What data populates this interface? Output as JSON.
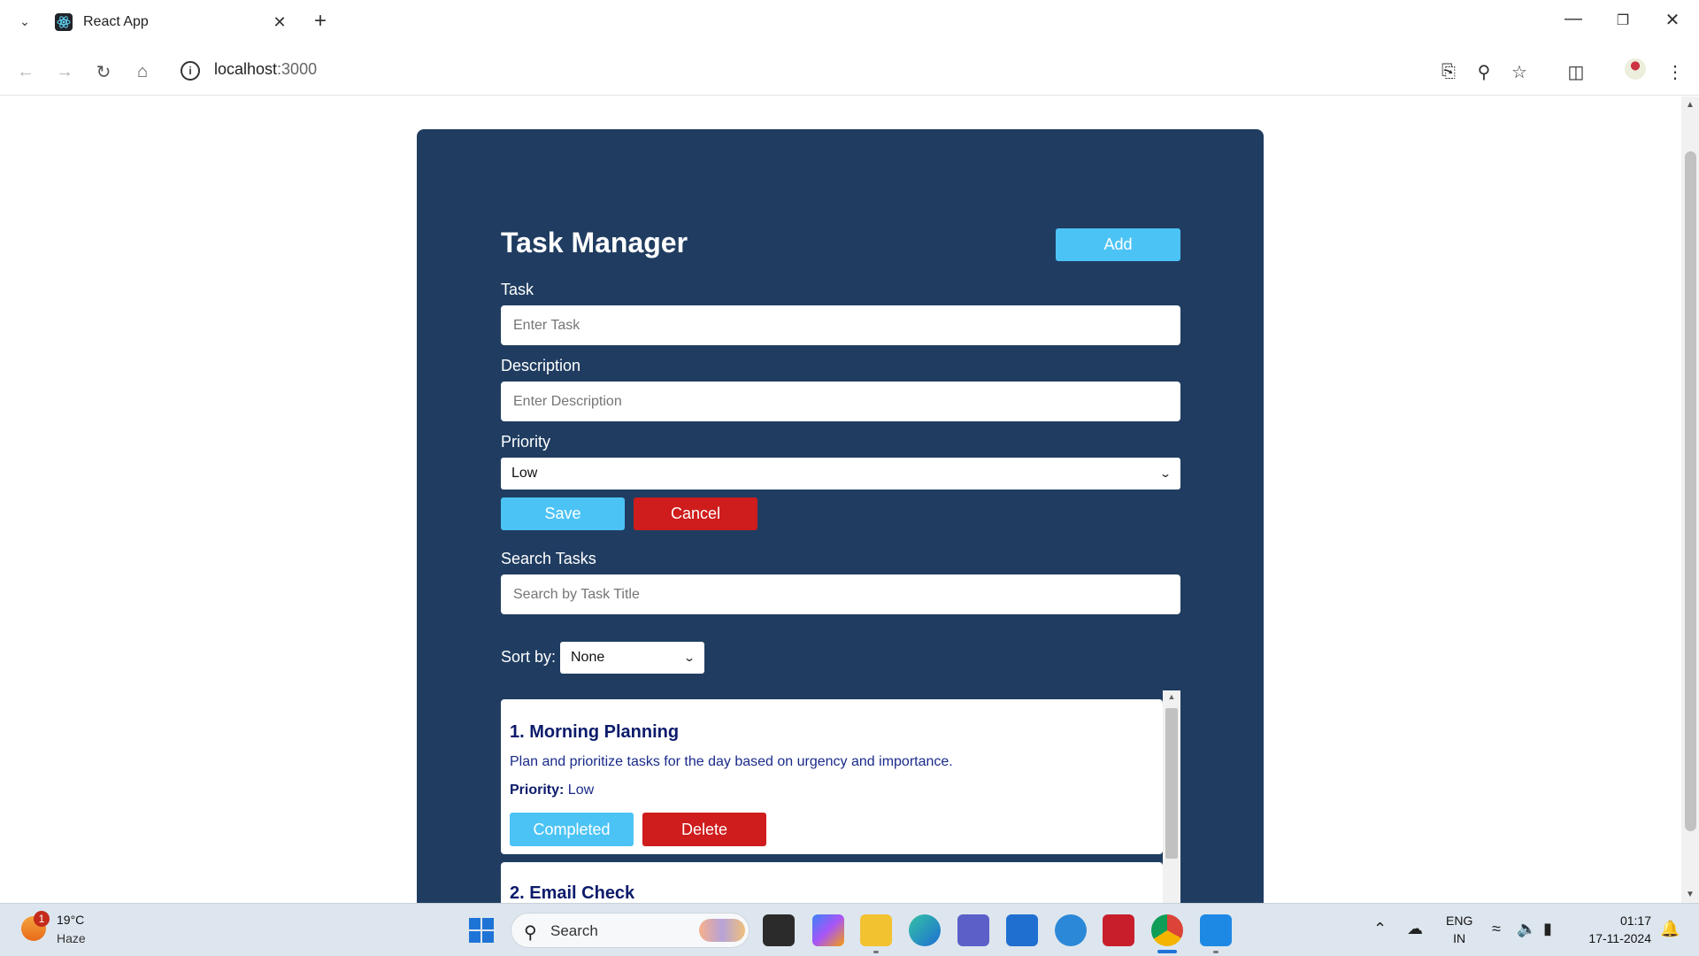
{
  "browser": {
    "tab_title": "React App",
    "url_host": "localhost",
    "url_port": ":3000"
  },
  "app": {
    "title": "Task Manager",
    "add_button": "Add",
    "task_label": "Task",
    "task_placeholder": "Enter Task",
    "description_label": "Description",
    "description_placeholder": "Enter Description",
    "priority_label": "Priority",
    "priority_selected": "Low",
    "save_button": "Save",
    "cancel_button": "Cancel",
    "search_label": "Search Tasks",
    "search_placeholder": "Search by Task Title",
    "sort_label": "Sort by:",
    "sort_selected": "None",
    "colors": {
      "panel": "#203d61",
      "accent": "#4cc3f5",
      "danger": "#cf1c1c"
    }
  },
  "tasks": [
    {
      "title": "1. Morning Planning",
      "description": "Plan and prioritize tasks for the day based on urgency and importance.",
      "priority_label": "Priority:",
      "priority_value": "Low",
      "complete_button": "Completed",
      "delete_button": "Delete"
    },
    {
      "title": "2. Email Check"
    }
  ],
  "taskbar": {
    "weather_badge": "1",
    "temperature": "19°C",
    "weather": "Haze",
    "search": "Search",
    "lang_line1": "ENG",
    "lang_line2": "IN",
    "time": "01:17",
    "date": "17-11-2024"
  }
}
